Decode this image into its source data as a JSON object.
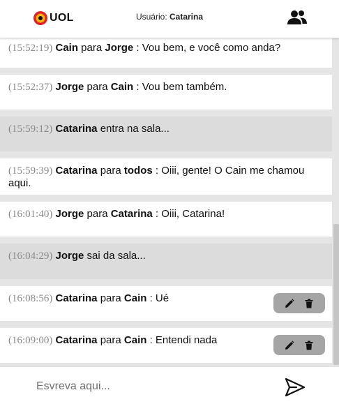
{
  "header": {
    "logo_text": "UOL",
    "user_prefix": "Usuário:",
    "user_name": "Catarina"
  },
  "messages": [
    {
      "time": "(15:52:19)",
      "from": "Cain",
      "connector": " para ",
      "to": "Jorge",
      "text": " : Vou bem, e você como anda?",
      "kind": "normal"
    },
    {
      "time": "(15:52:37)",
      "from": "Jorge",
      "connector": " para ",
      "to": "Cain",
      "text": " : Vou bem também.",
      "kind": "normal"
    },
    {
      "time": "(15:59:12)",
      "from": "Catarina",
      "connector": "",
      "to": "",
      "text": " entra na sala...",
      "kind": "status"
    },
    {
      "time": "(15:59:39)",
      "from": "Catarina",
      "connector": " para ",
      "to": "todos",
      "text": " : Oiii, gente! O Cain me chamou aqui.",
      "kind": "normal"
    },
    {
      "time": "(16:01:40)",
      "from": "Jorge",
      "connector": " para ",
      "to": "Catarina",
      "text": " : Oiii, Catarina!",
      "kind": "normal"
    },
    {
      "time": "(16:04:29)",
      "from": "Jorge",
      "connector": "",
      "to": "",
      "text": " sai da sala...",
      "kind": "status"
    },
    {
      "time": "(16:08:56)",
      "from": "Catarina",
      "connector": " para ",
      "to": "Cain",
      "text": " : Ué",
      "kind": "normal",
      "editable": true
    },
    {
      "time": "(16:09:00)",
      "from": "Catarina",
      "connector": " para ",
      "to": "Cain",
      "text": " : Entendi nada",
      "kind": "normal",
      "editable": true
    }
  ],
  "composer": {
    "placeholder": "Esvreva aqui...",
    "value": ""
  },
  "icons": {
    "logo": "uol-logo",
    "participants": "people-icon",
    "edit": "pencil-icon",
    "delete": "trash-icon",
    "send": "paper-plane-icon"
  },
  "colors": {
    "logo_red": "#e0202a",
    "logo_yellow": "#f7b500",
    "status_row": "#dcdcdc",
    "action_pill": "#a5a5a5"
  }
}
